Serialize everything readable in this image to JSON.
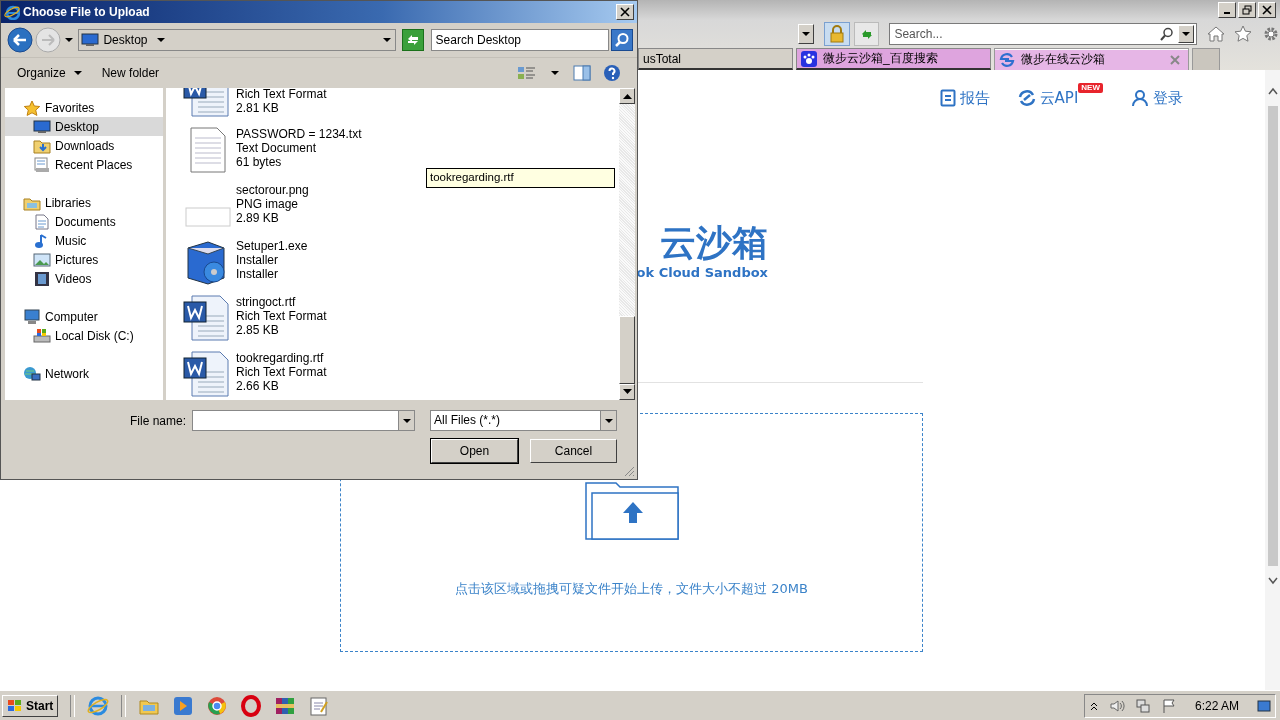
{
  "browser": {
    "tabs": [
      {
        "label": "usTotal",
        "selected": false,
        "color": "#d4d0c8",
        "kind": "plain"
      },
      {
        "label": "微步云沙箱_百度搜索",
        "selected": false,
        "color": "#dea4de",
        "kind": "paw"
      },
      {
        "label": "微步在线云沙箱",
        "selected": true,
        "color": "#e6b6e6",
        "kind": "swirl"
      }
    ],
    "search": {
      "placeholder": "Search..."
    },
    "nav": [
      {
        "label": "报告",
        "kind": "report"
      },
      {
        "label": "云API",
        "kind": "api",
        "badge": "NEW"
      },
      {
        "label": "登录",
        "kind": "login"
      }
    ],
    "logo": {
      "title": "云沙箱",
      "subtitle": "ok Cloud Sandbox"
    },
    "upload": {
      "hint": "点击该区域或拖拽可疑文件开始上传，文件大小不超过 20MB"
    }
  },
  "dialog": {
    "title": "Choose File to Upload",
    "location": "Desktop",
    "search": {
      "placeholder": "Search Desktop"
    },
    "toolbar": [
      "Organize",
      "New folder"
    ],
    "sidebar": [
      {
        "label": "Favorites",
        "kind": "star",
        "selected": false,
        "children": [
          {
            "label": "Desktop",
            "kind": "desktop",
            "selected": true
          },
          {
            "label": "Downloads",
            "kind": "downloads",
            "selected": false
          },
          {
            "label": "Recent Places",
            "kind": "recent",
            "selected": false
          }
        ]
      },
      {
        "label": "Libraries",
        "kind": "library",
        "selected": false,
        "children": [
          {
            "label": "Documents",
            "kind": "document",
            "selected": false
          },
          {
            "label": "Music",
            "kind": "music",
            "selected": false
          },
          {
            "label": "Pictures",
            "kind": "pictures",
            "selected": false
          },
          {
            "label": "Videos",
            "kind": "videos",
            "selected": false
          }
        ]
      },
      {
        "label": "Computer",
        "kind": "computer",
        "selected": false,
        "children": [
          {
            "label": "Local Disk (C:)",
            "kind": "disk",
            "selected": false
          }
        ]
      },
      {
        "label": "Network",
        "kind": "network",
        "selected": false
      }
    ],
    "files": [
      {
        "type": "Rich Text Format",
        "size": "2.81 KB",
        "kind": "rtf"
      },
      {
        "name": "PASSWORD  =  1234.txt",
        "type": "Text Document",
        "size": "61 bytes",
        "kind": "txt"
      },
      {
        "name": "sectorour.png",
        "type": "PNG image",
        "size": "2.89 KB",
        "kind": "png"
      },
      {
        "name": "Setuper1.exe",
        "type": "Installer",
        "size": "Installer",
        "kind": "exe"
      },
      {
        "name": "stringoct.rtf",
        "type": "Rich Text Format",
        "size": "2.85 KB",
        "kind": "rtf"
      },
      {
        "name": "tookregarding.rtf",
        "type": "Rich Text Format",
        "size": "2.66 KB",
        "kind": "rtf"
      }
    ],
    "tooltip": "tookregarding.rtf",
    "file_name": {
      "label": "File name:"
    },
    "file_type": "All Files (*.*)",
    "buttons": [
      "Open",
      "Cancel"
    ]
  },
  "taskbar": {
    "start": "Start",
    "clock": "6:22 AM"
  }
}
